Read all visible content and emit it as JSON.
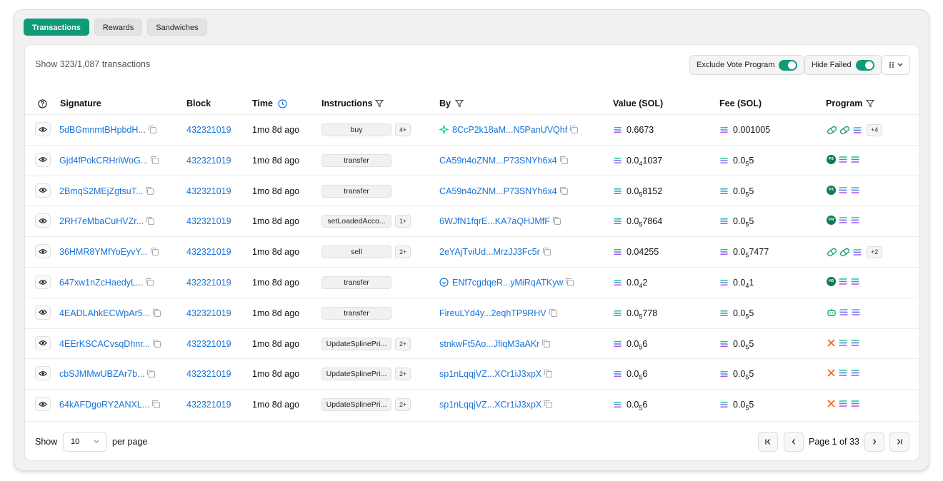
{
  "tabs": [
    {
      "label": "Transactions",
      "active": true
    },
    {
      "label": "Rewards",
      "active": false
    },
    {
      "label": "Sandwiches",
      "active": false
    }
  ],
  "summary": "Show 323/1,087 transactions",
  "toggles": {
    "exclude_vote": "Exclude Vote Program",
    "hide_failed": "Hide Failed"
  },
  "headers": {
    "signature": "Signature",
    "block": "Block",
    "time": "Time",
    "instructions": "Instructions",
    "by": "By",
    "value": "Value (SOL)",
    "fee": "Fee (SOL)",
    "program": "Program"
  },
  "rows": [
    {
      "sig": "5dBGmnmtBHpbdH...",
      "block": "432321019",
      "time": "1mo 8d ago",
      "instr": "buy",
      "more": "4+",
      "by": "8CcP2k18aM...N5PanUVQhf",
      "by_icon": "sparkle",
      "value": [
        "0.6673",
        "",
        ""
      ],
      "fee": [
        "0.001005",
        "",
        ""
      ],
      "progs": [
        "pill",
        "pill",
        "sol"
      ],
      "pmore": "+4"
    },
    {
      "sig": "Gjd4fPokCRHriWoG...",
      "block": "432321019",
      "time": "1mo 8d ago",
      "instr": "transfer",
      "more": "",
      "by": "CA59n4oZNM...P73SNYh6x4",
      "by_icon": "",
      "value": [
        "0.0",
        "4",
        "1037"
      ],
      "fee": [
        "0.0",
        "5",
        "5"
      ],
      "progs": [
        "P3",
        "sol",
        "sol"
      ],
      "pmore": ""
    },
    {
      "sig": "2BmqS2MEjZgtsuT...",
      "block": "432321019",
      "time": "1mo 8d ago",
      "instr": "transfer",
      "more": "",
      "by": "CA59n4oZNM...P73SNYh6x4",
      "by_icon": "",
      "value": [
        "0.0",
        "5",
        "8152"
      ],
      "fee": [
        "0.0",
        "5",
        "5"
      ],
      "progs": [
        "P3",
        "sol",
        "sol"
      ],
      "pmore": ""
    },
    {
      "sig": "2RH7eMbaCuHVZr...",
      "block": "432321019",
      "time": "1mo 8d ago",
      "instr": "setLoadedAcco...",
      "more": "1+",
      "by": "6WJfN1fqrE...KA7aQHJMfF",
      "by_icon": "",
      "value": [
        "0.0",
        "5",
        "7864"
      ],
      "fee": [
        "0.0",
        "5",
        "5"
      ],
      "progs": [
        "FN",
        "sol",
        "sol"
      ],
      "pmore": ""
    },
    {
      "sig": "36HMR8YMfYoEyvY...",
      "block": "432321019",
      "time": "1mo 8d ago",
      "instr": "sell",
      "more": "2+",
      "by": "2eYAjTviUd...MrzJJ3Fc5r",
      "by_icon": "",
      "value": [
        "0.04255",
        "",
        ""
      ],
      "fee": [
        "0.0",
        "5",
        "7477"
      ],
      "progs": [
        "pill",
        "pill",
        "sol"
      ],
      "pmore": "+2"
    },
    {
      "sig": "647xw1nZcHaedyL...",
      "block": "432321019",
      "time": "1mo 8d ago",
      "instr": "transfer",
      "more": "",
      "by": "ENf7cgdqeR...yMiRqATKyw",
      "by_icon": "verified",
      "value": [
        "0.0",
        "4",
        "2"
      ],
      "fee": [
        "0.0",
        "4",
        "1"
      ],
      "progs": [
        "H5",
        "sol",
        "sol"
      ],
      "pmore": ""
    },
    {
      "sig": "4EADLAhkECWpAr5...",
      "block": "432321019",
      "time": "1mo 8d ago",
      "instr": "transfer",
      "more": "",
      "by": "FireuLYd4y...2eqhTP9RHV",
      "by_icon": "",
      "value": [
        "0.0",
        "5",
        "778"
      ],
      "fee": [
        "0.0",
        "5",
        "5"
      ],
      "progs": [
        "bot",
        "sol",
        "sol"
      ],
      "pmore": ""
    },
    {
      "sig": "4EErKSCACvsqDhnr...",
      "block": "432321019",
      "time": "1mo 8d ago",
      "instr": "UpdateSplinePri...",
      "more": "2+",
      "by": "stnkwFt5Ao...JfiqM3aAKr",
      "by_icon": "",
      "value": [
        "0.0",
        "5",
        "6"
      ],
      "fee": [
        "0.0",
        "5",
        "5"
      ],
      "progs": [
        "x",
        "sol",
        "sol"
      ],
      "pmore": ""
    },
    {
      "sig": "cbSJMMwUBZAr7b...",
      "block": "432321019",
      "time": "1mo 8d ago",
      "instr": "UpdateSplinePri...",
      "more": "2+",
      "by": "sp1nLqqjVZ...XCr1iJ3xpX",
      "by_icon": "",
      "value": [
        "0.0",
        "5",
        "6"
      ],
      "fee": [
        "0.0",
        "5",
        "5"
      ],
      "progs": [
        "x",
        "sol",
        "sol"
      ],
      "pmore": ""
    },
    {
      "sig": "64kAFDgoRY2ANXL...",
      "block": "432321019",
      "time": "1mo 8d ago",
      "instr": "UpdateSplinePri...",
      "more": "2+",
      "by": "sp1nLqqjVZ...XCr1iJ3xpX",
      "by_icon": "",
      "value": [
        "0.0",
        "5",
        "6"
      ],
      "fee": [
        "0.0",
        "5",
        "5"
      ],
      "progs": [
        "x",
        "sol",
        "sol"
      ],
      "pmore": ""
    }
  ],
  "footer": {
    "show": "Show",
    "per_page_value": "10",
    "per_page": "per page",
    "page_text": "Page 1 of 33"
  },
  "colors": {
    "accent": "#0f9a78",
    "link": "#1a73d9"
  }
}
